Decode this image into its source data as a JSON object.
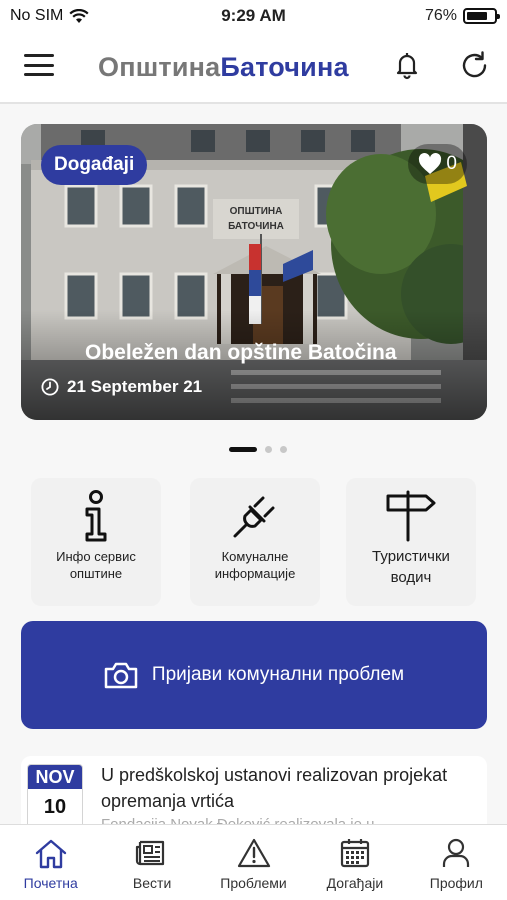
{
  "status_bar": {
    "carrier": "No SIM",
    "time": "9:29 AM",
    "battery": "76%",
    "battery_level": 0.76
  },
  "header": {
    "brand_part1": "Општина",
    "brand_part2": "Баточина",
    "accent_color": "#2f3ca0"
  },
  "carousel": {
    "category": "Događaji",
    "likes": "0",
    "title": "Obeležen dan opštine Batočina",
    "date": "21 September 21",
    "photo_sign": "ОПШТИНА БАТОЧИНА",
    "slide_count": 3,
    "active_slide": 1
  },
  "quick_links": [
    {
      "label_line1": "Инфо сервис",
      "label_line2": "општине",
      "icon": "info-icon"
    },
    {
      "label_line1": "Комуналне",
      "label_line2": "информације",
      "icon": "plug-icon"
    },
    {
      "label_line1": "Туристички",
      "label_line2": "водич",
      "icon": "signpost-icon"
    }
  ],
  "report_button": {
    "label": "Пријави комунални проблем",
    "icon": "camera-icon"
  },
  "news": [
    {
      "month": "NOV",
      "day": "10",
      "title": "U predškolskoj ustanovi realizovan projekat opremanja vrtića",
      "excerpt": "Fondacija Novak Đoković realizovala je u"
    }
  ],
  "tab_bar": [
    {
      "label": "Почетна",
      "icon": "home-icon",
      "active": true
    },
    {
      "label": "Вести",
      "icon": "newspaper-icon",
      "active": false
    },
    {
      "label": "Проблеми",
      "icon": "warning-icon",
      "active": false
    },
    {
      "label": "Догађаји",
      "icon": "calendar-icon",
      "active": false
    },
    {
      "label": "Профил",
      "icon": "user-icon",
      "active": false
    }
  ]
}
